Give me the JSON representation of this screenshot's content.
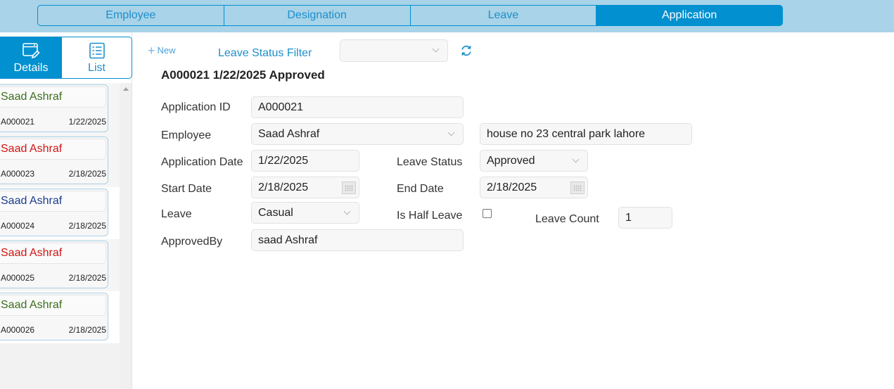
{
  "tabs": [
    {
      "label": "Employee",
      "active": false
    },
    {
      "label": "Designation",
      "active": false
    },
    {
      "label": "Leave",
      "active": false
    },
    {
      "label": "Application",
      "active": true
    }
  ],
  "view_switch": {
    "details_label": "Details",
    "list_label": "List",
    "details_icon": "window-edit-icon",
    "list_icon": "list-icon"
  },
  "list_items": [
    {
      "name": "Saad Ashraf",
      "id": "A000021",
      "date": "1/22/2025",
      "name_color": "#3c6e1e"
    },
    {
      "name": "Saad Ashraf",
      "id": "A000023",
      "date": "2/18/2025",
      "name_color": "#d21414"
    },
    {
      "name": "Saad Ashraf",
      "id": "A000024",
      "date": "2/18/2025",
      "name_color": "#1a3b8f"
    },
    {
      "name": "Saad Ashraf",
      "id": "A000025",
      "date": "2/18/2025",
      "name_color": "#d21414"
    },
    {
      "name": "Saad Ashraf",
      "id": "A000026",
      "date": "2/18/2025",
      "name_color": "#3c6e1e"
    }
  ],
  "toolbar": {
    "new_label": "New",
    "filter_label": "Leave Status Filter",
    "filter_value": ""
  },
  "record": {
    "title": "A000021 1/22/2025 Approved",
    "labels": {
      "application_id": "Application ID",
      "employee": "Employee",
      "application_date": "Application Date",
      "leave_status": "Leave Status",
      "start_date": "Start Date",
      "end_date": "End Date",
      "leave": "Leave",
      "is_half_leave": "Is Half Leave",
      "leave_count": "Leave Count",
      "approved_by": "ApprovedBy"
    },
    "values": {
      "application_id": "A000021",
      "employee": "Saad Ashraf",
      "employee_address": "house no 23 central park lahore",
      "application_date": "1/22/2025",
      "leave_status": "Approved",
      "start_date": "2/18/2025",
      "end_date": "2/18/2025",
      "leave": "Casual",
      "is_half_leave": false,
      "leave_count": "1",
      "approved_by": "saad Ashraf"
    }
  },
  "colors": {
    "accent": "#0290d0",
    "header_bg": "#a8d3e8"
  }
}
